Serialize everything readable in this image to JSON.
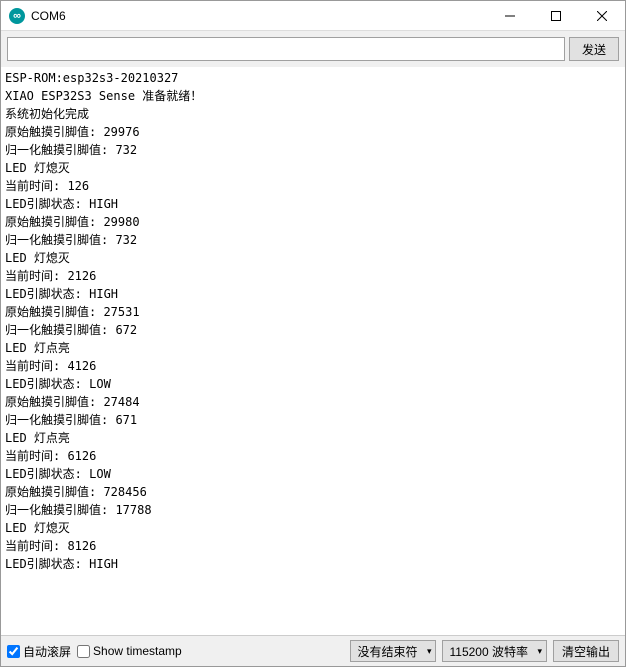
{
  "window": {
    "title": "COM6"
  },
  "input": {
    "value": "",
    "send_label": "发送"
  },
  "console": {
    "lines": [
      "ESP-ROM:esp32s3-20210327",
      "XIAO ESP32S3 Sense 准备就绪！",
      "系统初始化完成",
      "原始触摸引脚值: 29976",
      "归一化触摸引脚值: 732",
      "LED 灯熄灭",
      "当前时间: 126",
      "LED引脚状态: HIGH",
      "原始触摸引脚值: 29980",
      "归一化触摸引脚值: 732",
      "LED 灯熄灭",
      "当前时间: 2126",
      "LED引脚状态: HIGH",
      "原始触摸引脚值: 27531",
      "归一化触摸引脚值: 672",
      "LED 灯点亮",
      "当前时间: 4126",
      "LED引脚状态: LOW",
      "原始触摸引脚值: 27484",
      "归一化触摸引脚值: 671",
      "LED 灯点亮",
      "当前时间: 6126",
      "LED引脚状态: LOW",
      "原始触摸引脚值: 728456",
      "归一化触摸引脚值: 17788",
      "LED 灯熄灭",
      "当前时间: 8126",
      "LED引脚状态: HIGH"
    ]
  },
  "bottom": {
    "autoscroll_label": "自动滚屏",
    "autoscroll_checked": true,
    "timestamp_label": "Show timestamp",
    "timestamp_checked": false,
    "line_ending": "没有结束符",
    "baud_rate": "115200 波特率",
    "clear_label": "清空输出"
  }
}
